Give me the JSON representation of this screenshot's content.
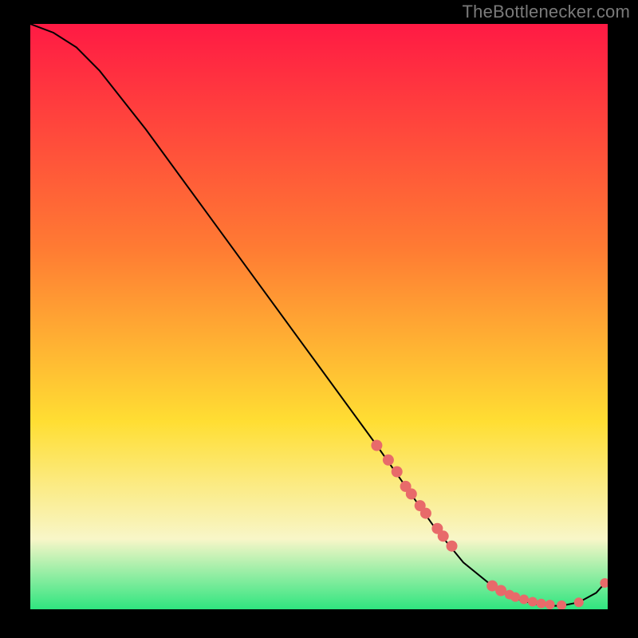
{
  "attribution": "TheBottlenecker.com",
  "colors": {
    "bg_black": "#000000",
    "grad_red": "#ff1a44",
    "grad_orange": "#ff7a33",
    "grad_yellow": "#ffde33",
    "grad_pale": "#f8f6c8",
    "grad_green": "#2fe57f",
    "line": "#000000",
    "dot": "#e86a6a"
  },
  "chart_data": {
    "type": "line",
    "title": "",
    "xlabel": "",
    "ylabel": "",
    "xlim": [
      0,
      100
    ],
    "ylim": [
      0,
      100
    ],
    "series": [
      {
        "name": "bottleneck-curve",
        "x": [
          0,
          4,
          8,
          12,
          20,
          30,
          40,
          50,
          60,
          65,
          70,
          75,
          80,
          85,
          88,
          90,
          92,
          95,
          98,
          100
        ],
        "y": [
          100,
          98.5,
          96,
          92,
          82,
          68.5,
          55,
          41.5,
          28,
          21,
          14,
          8,
          4,
          1.5,
          0.8,
          0.6,
          0.6,
          1.2,
          2.8,
          5
        ]
      }
    ],
    "dots": {
      "name": "highlight-points",
      "x": [
        60,
        62,
        63.5,
        65,
        66,
        67.5,
        68.5,
        70.5,
        71.5,
        73,
        80,
        81.5,
        83,
        84,
        85.5,
        87,
        88.5,
        90,
        92,
        95,
        99.5
      ],
      "y": [
        28,
        25.5,
        23.5,
        21,
        19.7,
        17.7,
        16.4,
        13.8,
        12.5,
        10.8,
        4,
        3.2,
        2.5,
        2.1,
        1.7,
        1.3,
        1.0,
        0.8,
        0.7,
        1.2,
        4.5
      ]
    }
  }
}
